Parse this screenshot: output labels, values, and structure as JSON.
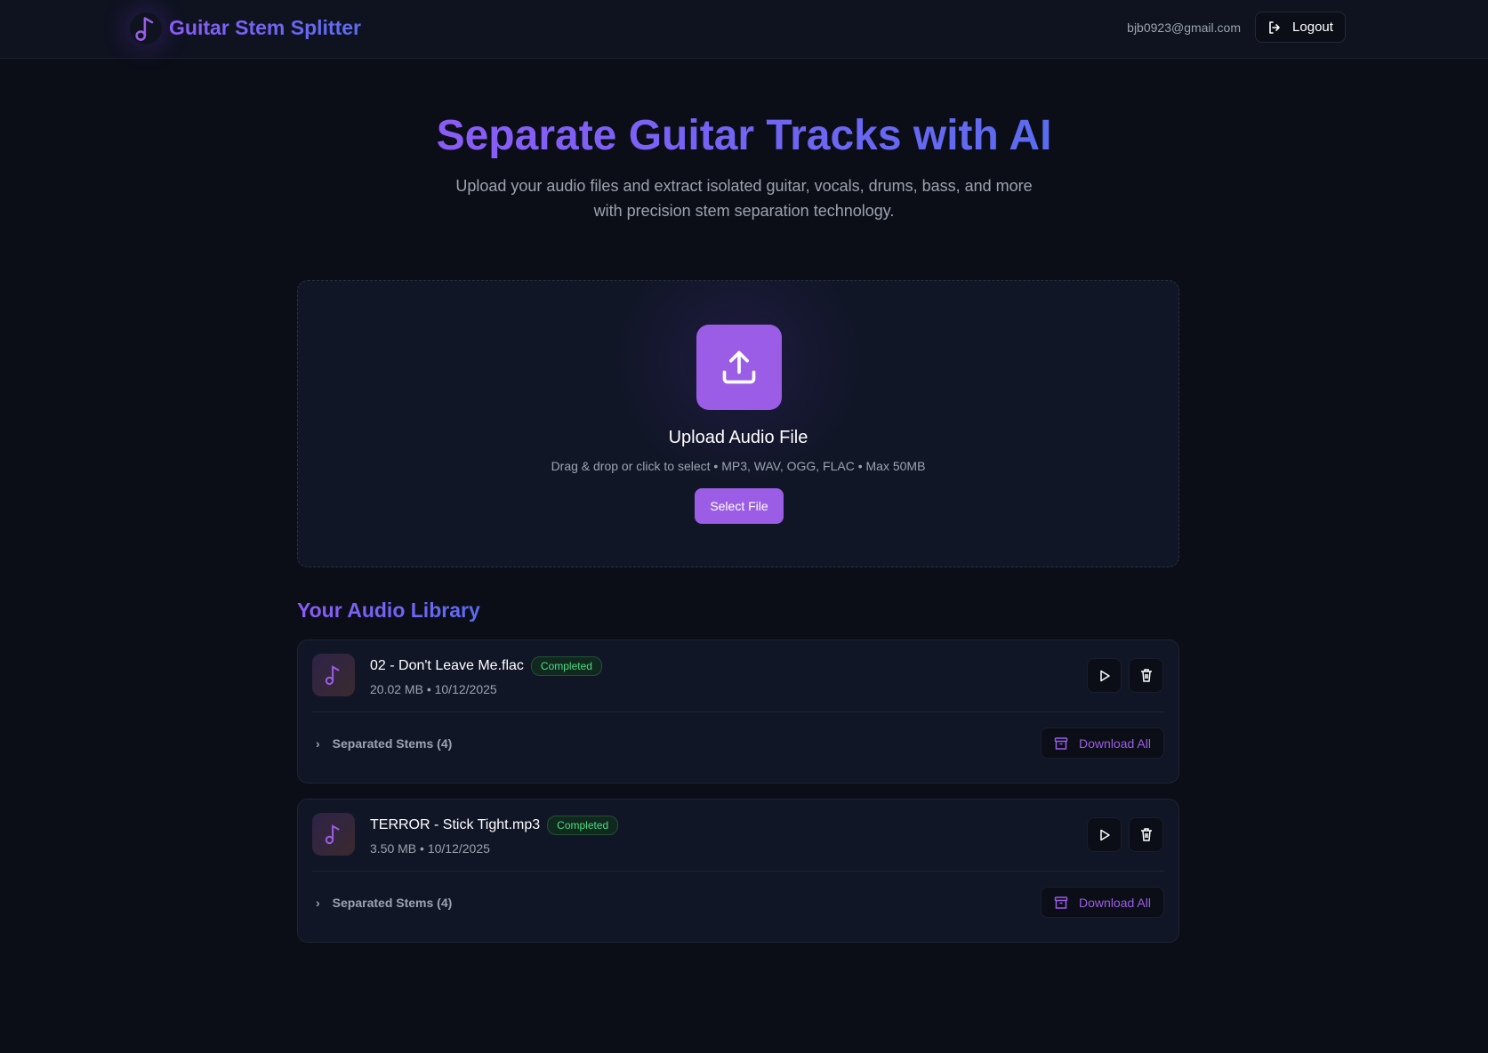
{
  "header": {
    "brand": "Guitar Stem Splitter",
    "email": "bjb0923@gmail.com",
    "logout_label": "Logout"
  },
  "hero": {
    "title": "Separate Guitar Tracks with AI",
    "subtitle_line1": "Upload your audio files and extract isolated guitar, vocals, drums, bass, and more",
    "subtitle_line2": "with precision stem separation technology."
  },
  "upload": {
    "title": "Upload Audio File",
    "subtitle": "Drag & drop or click to select • MP3, WAV, OGG, FLAC • Max 50MB",
    "button_label": "Select File"
  },
  "library": {
    "title": "Your Audio Library",
    "items": [
      {
        "name": "02 - Don't Leave Me.flac",
        "status": "Completed",
        "meta": "20.02 MB • 10/12/2025",
        "stems_label": "Separated Stems (4)",
        "download_label": "Download All"
      },
      {
        "name": "TERROR - Stick Tight.mp3",
        "status": "Completed",
        "meta": "3.50 MB • 10/12/2025",
        "stems_label": "Separated Stems (4)",
        "download_label": "Download All"
      }
    ]
  },
  "colors": {
    "accent": "#9b5de5",
    "gradient_end": "#5b6cf0",
    "success": "#4ade80",
    "background": "#0b0e17"
  }
}
